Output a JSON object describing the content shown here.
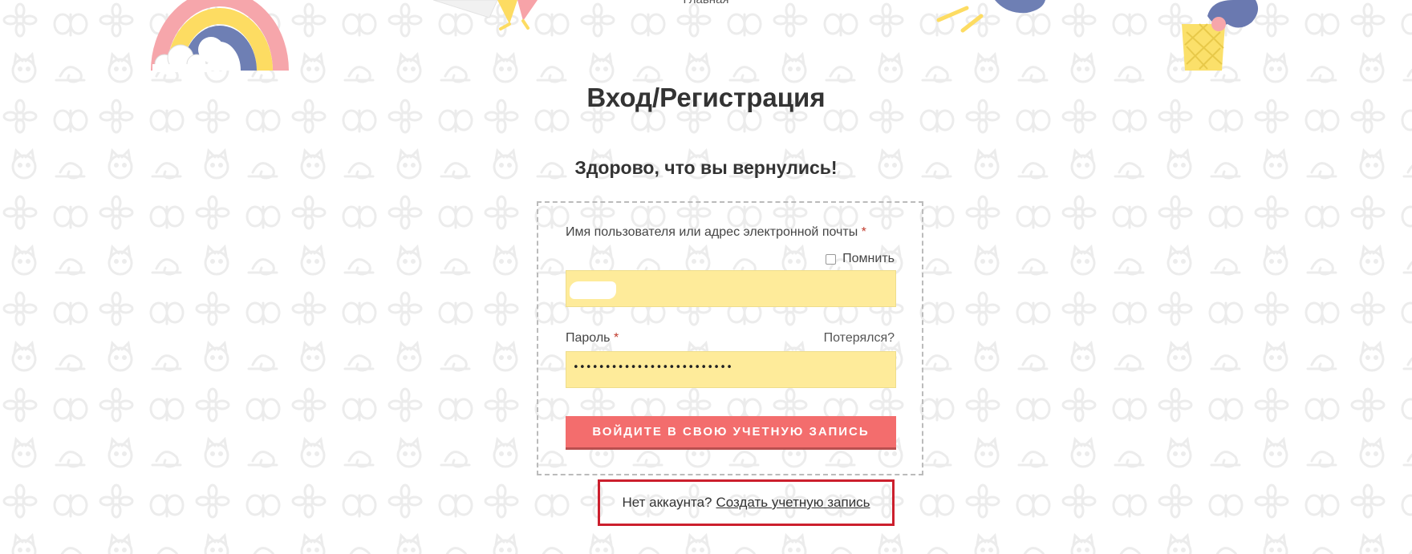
{
  "header": {
    "crumb": "Главная"
  },
  "page": {
    "title": "Вход/Регистрация",
    "welcome": "Здорово, что вы вернулись!"
  },
  "login_form": {
    "username_label": "Имя пользователя или адрес электронной почты",
    "required_mark": "*",
    "remember_label": "Помнить",
    "remember_checked": false,
    "password_label": "Пароль",
    "lost_password_link": "Потерялся?",
    "password_value_masked": "•••••••••••••••••••••••••",
    "submit_label": "ВОЙДИТЕ В СВОЮ УЧЕТНУЮ ЗАПИСЬ"
  },
  "register": {
    "prompt": "Нет аккаунта?",
    "link": "Создать учетную запись"
  },
  "colors": {
    "input_background": "#feeb9a",
    "submit_button": "#f36d6d",
    "highlight_border": "#cc1f2d",
    "rainbow": [
      "#f6a6ab",
      "#fddc62",
      "#6e7fb4"
    ],
    "ice_cream_cone": "#fbe06a",
    "ice_cream_scoop": "#6a79b0"
  },
  "decorations": [
    "rainbow-cloud-illustration",
    "paper-plane-illustration",
    "comet-illustration",
    "ice-cream-illustration",
    "doodle-pattern-background"
  ]
}
